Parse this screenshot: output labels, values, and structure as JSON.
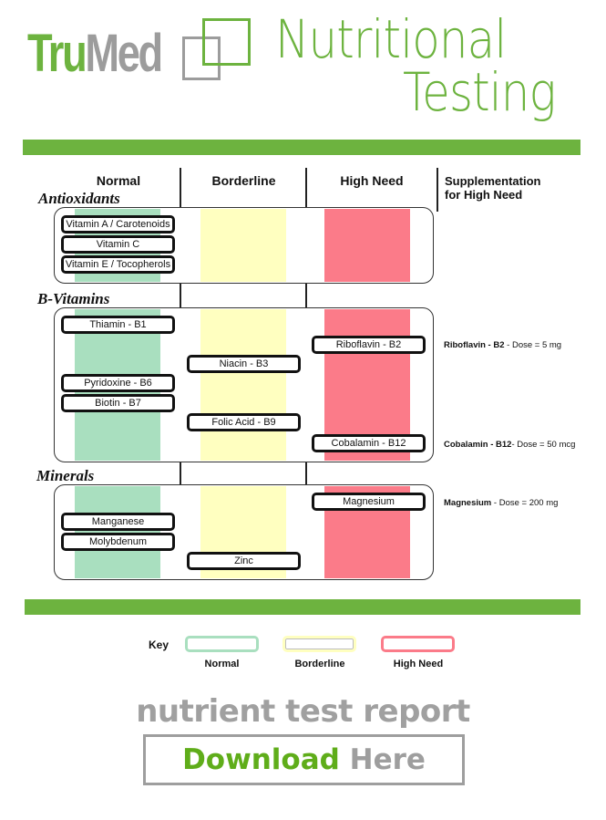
{
  "brand": {
    "name_part1": "Tru",
    "name_part2": "Med",
    "title_line1": "Nutritional",
    "title_line2": "Testing",
    "colors": {
      "green": "#6db33f",
      "gray": "#9c9c9c"
    }
  },
  "table": {
    "headers": [
      "Normal",
      "Borderline",
      "High Need"
    ],
    "supplement_header_line1": "Supplementation",
    "supplement_header_line2": "for High Need",
    "colors": {
      "normal": "#a9dfbf",
      "borderline": "#ffffc0",
      "high_need": "#fb7b89"
    },
    "categories": [
      {
        "name": "Antioxidants",
        "nutrients": [
          {
            "label": "Vitamin A / Carotenoids",
            "status": "Normal"
          },
          {
            "label": "Vitamin C",
            "status": "Normal"
          },
          {
            "label": "Vitamin E / Tocopherols",
            "status": "Normal"
          }
        ]
      },
      {
        "name": "B-Vitamins",
        "nutrients": [
          {
            "label": "Thiamin - B1",
            "status": "Normal"
          },
          {
            "label": "Riboflavin - B2",
            "status": "High Need"
          },
          {
            "label": "Niacin - B3",
            "status": "Borderline"
          },
          {
            "label": "Pyridoxine - B6",
            "status": "Normal"
          },
          {
            "label": "Biotin - B7",
            "status": "Normal"
          },
          {
            "label": "Folic Acid - B9",
            "status": "Borderline"
          },
          {
            "label": "Cobalamin - B12",
            "status": "High Need"
          }
        ]
      },
      {
        "name": "Minerals",
        "nutrients": [
          {
            "label": "Magnesium",
            "status": "High Need"
          },
          {
            "label": "Manganese",
            "status": "Normal"
          },
          {
            "label": "Molybdenum",
            "status": "Normal"
          },
          {
            "label": "Zinc",
            "status": "Borderline"
          }
        ]
      }
    ],
    "supplements": [
      {
        "name": "Riboflavin - B2",
        "dose": " - Dose = 5 mg"
      },
      {
        "name": "Cobalamin - B12",
        "dose": "- Dose = 50 mcg"
      },
      {
        "name": "Magnesium",
        "dose": " - Dose = 200 mg"
      }
    ]
  },
  "key": {
    "title": "Key",
    "items": [
      {
        "label": "Normal",
        "color": "#a9dfbf"
      },
      {
        "label": "Borderline",
        "color": "#ffffc0"
      },
      {
        "label": "High Need",
        "color": "#fb7b89"
      }
    ]
  },
  "footer": {
    "report_text": "nutrient test report",
    "download_word": "Download",
    "here_word": " Here"
  }
}
